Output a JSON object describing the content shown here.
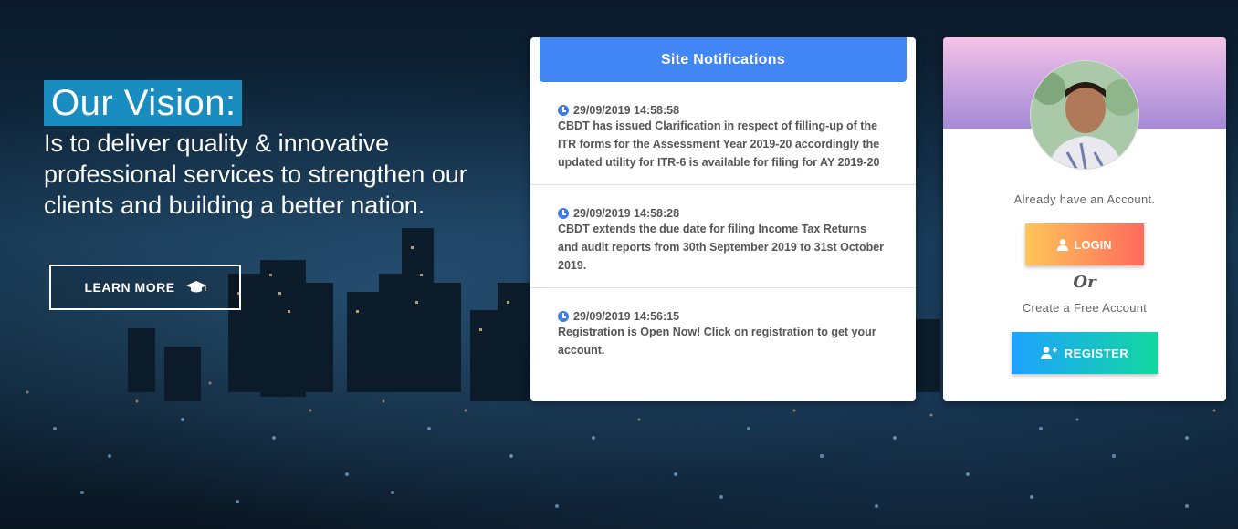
{
  "vision": {
    "title": "Our Vision:",
    "text": "Is to deliver quality & innovative professional services to strengthen our clients and building a better nation.",
    "button_label": "LEARN MORE",
    "button_icon": "graduation-cap-icon"
  },
  "notifications": {
    "title": "Site Notifications",
    "items": [
      {
        "date": "29/09/2019 14:58:58",
        "text": "CBDT has issued Clarification in respect of filling-up of the ITR forms for the Assessment Year 2019-20 accordingly the updated utility for ITR-6 is available for filing for AY 2019-20"
      },
      {
        "date": "29/09/2019 14:58:28",
        "text": "CBDT extends the due date for filing Income Tax Returns and audit reports from 30th September 2019 to 31st October 2019."
      },
      {
        "date": "29/09/2019 14:56:15",
        "text": "Registration is Open Now! Click on registration to get your account."
      }
    ]
  },
  "account": {
    "have_account_text": "Already have an Account.",
    "login_label": "LOGIN",
    "or_text": "Or",
    "create_text": "Create a Free Account",
    "register_label": "REGISTER"
  },
  "colors": {
    "notif_header": "#4285f4",
    "vision_highlight": "#1a8dc0",
    "login_gradient": [
      "#ffc65a",
      "#ff6a5b"
    ],
    "register_gradient": [
      "#1fa2ff",
      "#12d8a0"
    ]
  }
}
